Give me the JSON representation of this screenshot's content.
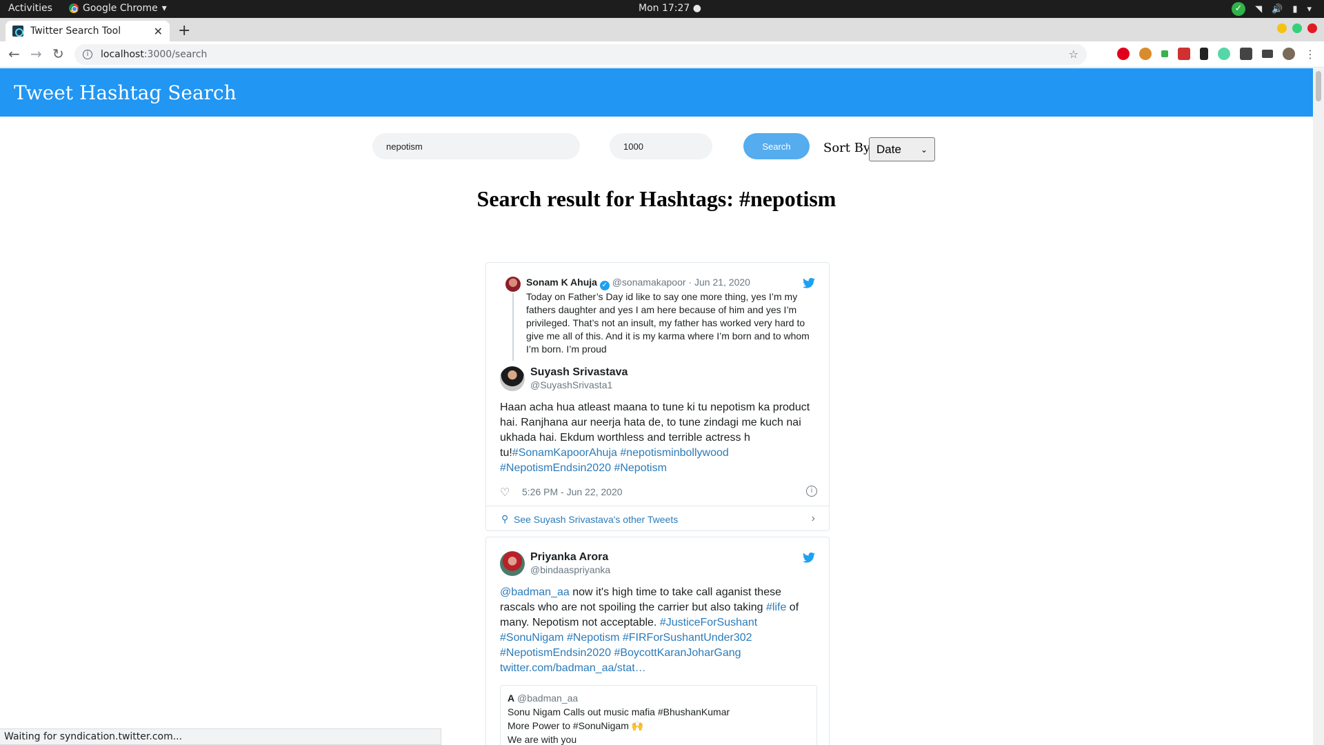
{
  "os_bar": {
    "activities": "Activities",
    "app_name": "Google Chrome",
    "clock": "Mon 17:27 ●"
  },
  "browser": {
    "tab_title": "Twitter Search Tool",
    "url_host": "localhost",
    "url_path": ":3000/search",
    "status_text": "Waiting for syndication.twitter.com..."
  },
  "app": {
    "title": "Tweet Hashtag Search",
    "search_value": "nepotism",
    "count_value": "1000",
    "search_button": "Search",
    "sort_label": "Sort By:",
    "sort_value": "Date",
    "results_title": "Search result for Hashtags: #nepotism"
  },
  "tweets": [
    {
      "quoted": {
        "name": "Sonam K Ahuja",
        "handle": "@sonamakapoor",
        "date": "· Jun 21, 2020",
        "text": "Today on Father’s Day id like to say one more thing, yes I’m my fathers daughter and yes I am here because of him and yes I’m privileged. That’s not an insult, my father has worked very hard to give me all of this. And it is my karma where I’m born and to whom I’m born. I’m proud"
      },
      "author": "Suyash Srivastava",
      "handle": "@SuyashSrivasta1",
      "text_plain": "Haan acha hua atleast maana to tune ki tu nepotism ka product hai. Ranjhana aur neerja hata de, to tune zindagi me kuch nai ukhada hai. Ekdum worthless and terrible actress h tu!",
      "tags_1": "#SonamKapoorAhuja #nepotisminbollywood",
      "tags_2": "#NepotismEndsin2020 #Nepotism",
      "time": "5:26 PM - Jun 22, 2020",
      "see_more": "See Suyash Srivastava's other Tweets"
    },
    {
      "author": "Priyanka Arora",
      "handle": "@bindaaspriyanka",
      "mention": "@badman_aa",
      "text_1": " now it's high time to take call aganist these",
      "text_2a": "rascals who are not spoiling the carrier but also taking ",
      "tag_life": "#life",
      "text_2b": " of",
      "text_3": "many. Nepotism not acceptable. ",
      "tag_justice": "#JusticeForSushant",
      "tags_line4": "#SonuNigam #Nepotism #FIRForSushantUnder302",
      "tags_line5": "#NepotismEndsin2020 #BoycottKaranJoharGang",
      "link": "twitter.com/badman_aa/stat…",
      "quote": {
        "initial": "A",
        "handle": "@badman_aa",
        "line1": "Sonu Nigam Calls out music mafia #BhushanKumar",
        "line2": "More Power to #SonuNigam 🙌",
        "line3": "We are with you"
      }
    }
  ],
  "colors": {
    "header": "#2196f3",
    "search_button": "#55acee",
    "link": "#2b7bb9",
    "twitter_blue": "#1da1f2"
  }
}
